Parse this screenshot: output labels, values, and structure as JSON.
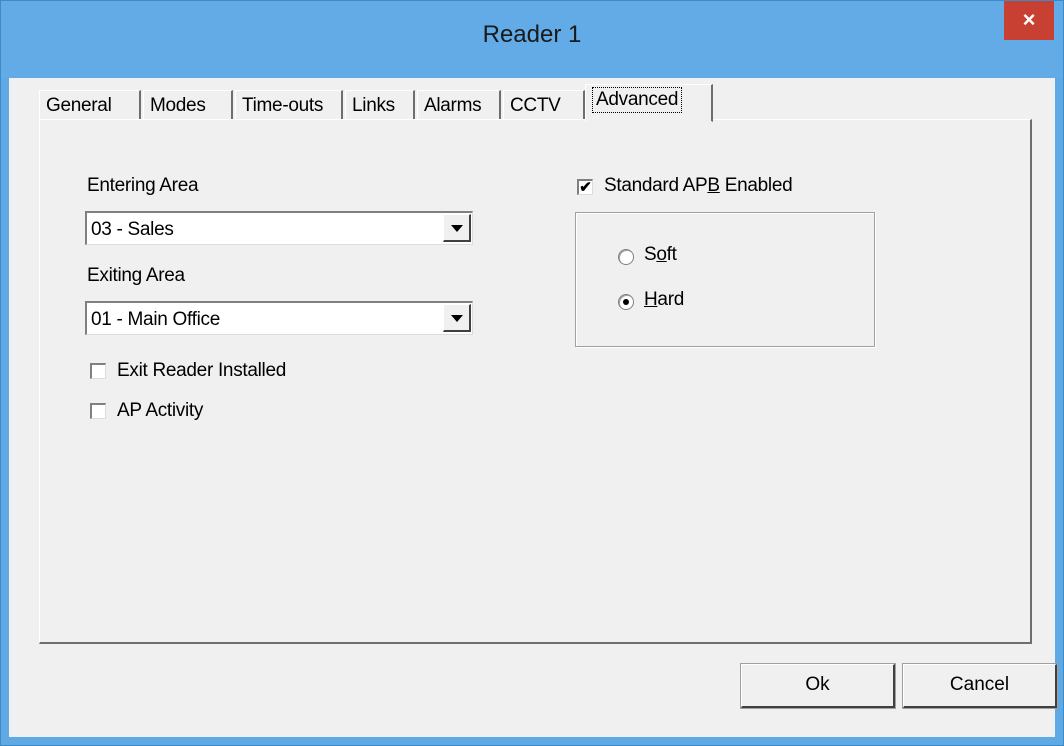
{
  "window": {
    "title": "Reader 1",
    "close_label": "×"
  },
  "tabs": [
    {
      "label": "General"
    },
    {
      "label": "Modes"
    },
    {
      "label": "Time-outs"
    },
    {
      "label": "Links"
    },
    {
      "label": "Alarms"
    },
    {
      "label": "CCTV"
    },
    {
      "label": "Advanced",
      "active": true
    }
  ],
  "advanced": {
    "entering_area_label": "Entering Area",
    "entering_area_value": "03 - Sales",
    "exiting_area_label": "Exiting Area",
    "exiting_area_value": "01 - Main Office",
    "exit_reader_installed_label": "Exit Reader Installed",
    "exit_reader_installed_checked": false,
    "ap_activity_label": "AP Activity",
    "ap_activity_checked": false,
    "standard_apb_label_pre": "Standard AP",
    "standard_apb_label_mnemonic": "B",
    "standard_apb_label_post": " Enabled",
    "standard_apb_checked": true,
    "apb_mode": {
      "soft_label_pre": "S",
      "soft_label_mnemonic": "o",
      "soft_label_post": "ft",
      "hard_label_mnemonic": "H",
      "hard_label_post": "ard",
      "selected": "Hard"
    }
  },
  "buttons": {
    "ok_label": "Ok",
    "cancel_label": "Cancel"
  },
  "glyphs": {
    "checkmark": "✔"
  }
}
